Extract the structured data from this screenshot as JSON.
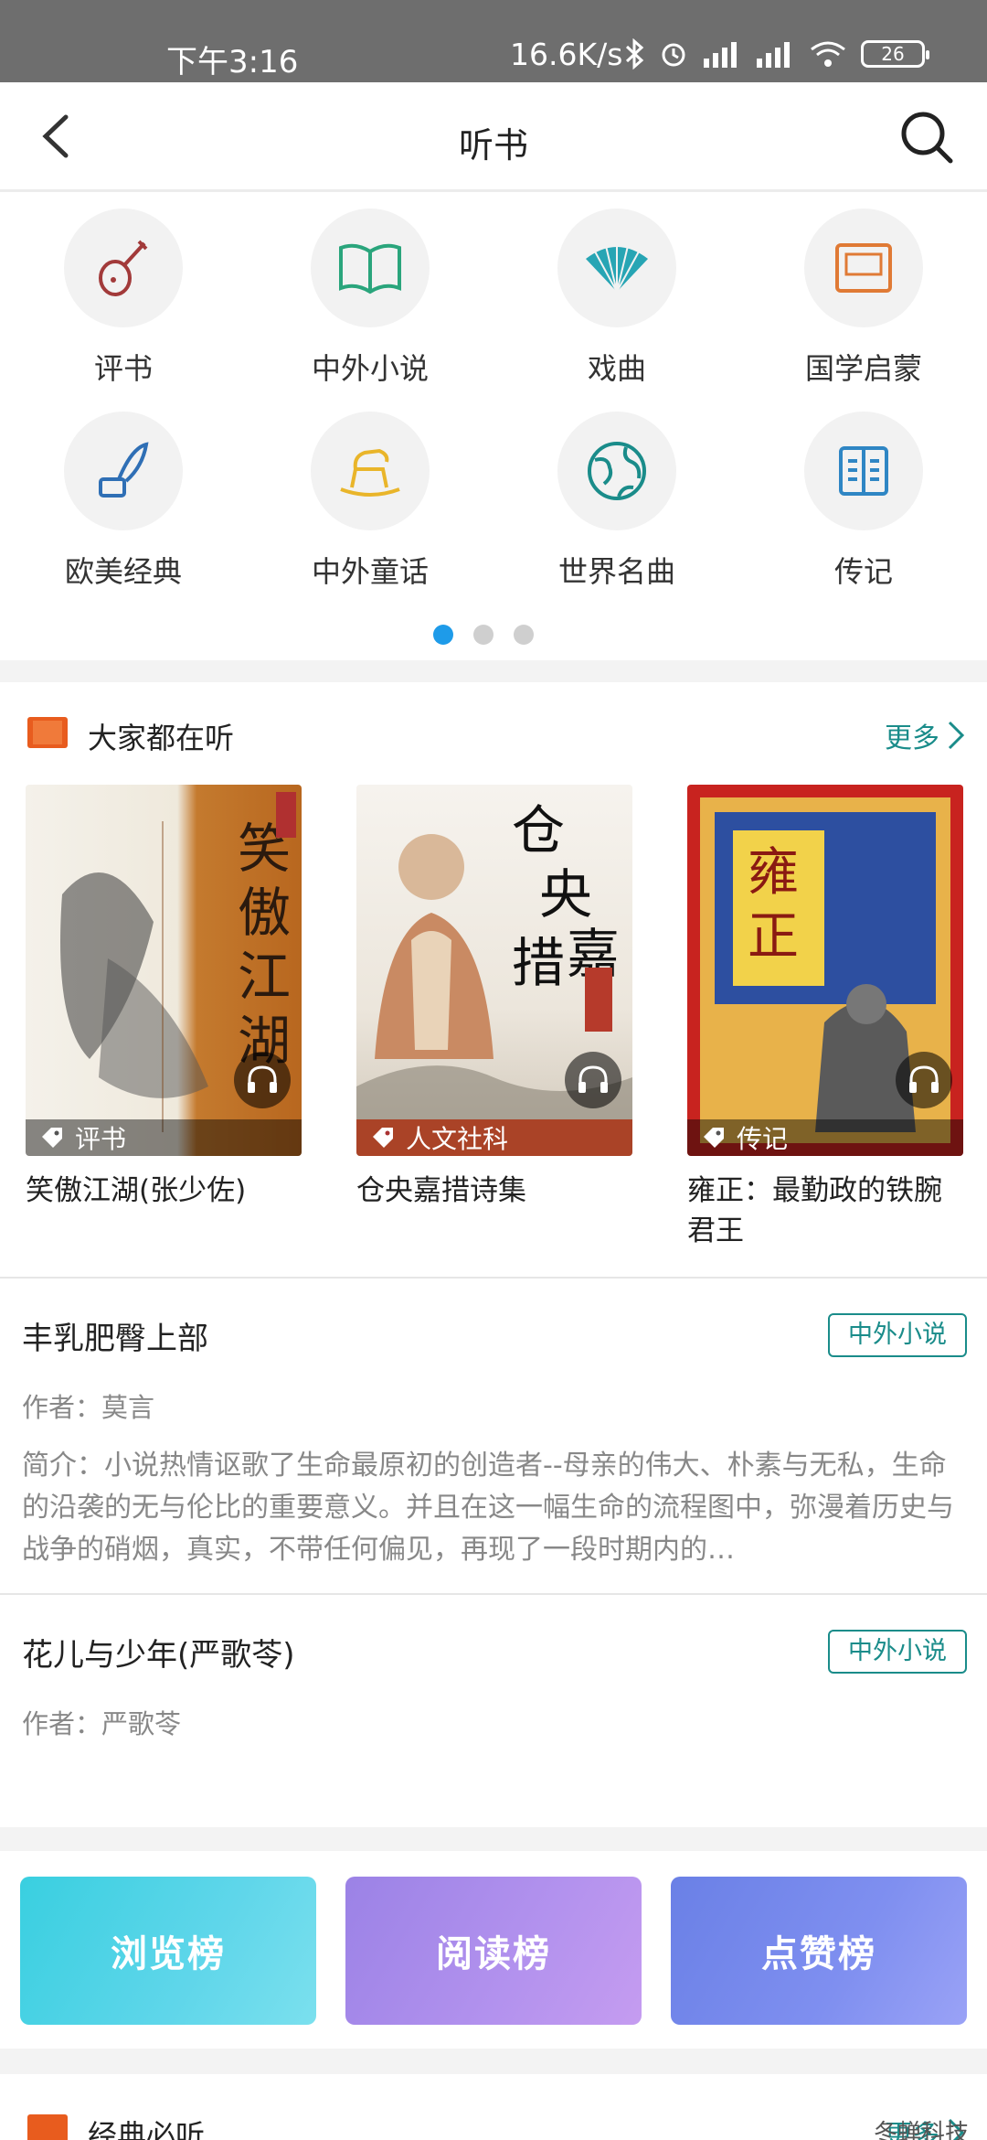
{
  "status": {
    "time": "下午3:16",
    "speed": "16.6K/s",
    "battery": "26"
  },
  "nav": {
    "title": "听书"
  },
  "categories": [
    {
      "label": "评书",
      "icon": "pipa-icon"
    },
    {
      "label": "中外小说",
      "icon": "open-book-icon"
    },
    {
      "label": "戏曲",
      "icon": "fan-icon"
    },
    {
      "label": "国学启蒙",
      "icon": "sishu-icon"
    },
    {
      "label": "欧美经典",
      "icon": "quill-ink-icon"
    },
    {
      "label": "中外童话",
      "icon": "rocking-horse-icon"
    },
    {
      "label": "世界名曲",
      "icon": "globe-icon"
    },
    {
      "label": "传记",
      "icon": "document-icon"
    }
  ],
  "pager": {
    "active_index": 0,
    "count": 3
  },
  "popular": {
    "title": "大家都在听",
    "more": "更多",
    "books": [
      {
        "title": "笑傲江湖(张少佐)",
        "tag": "评书"
      },
      {
        "title": "仓央嘉措诗集",
        "tag": "人文社科"
      },
      {
        "title": "雍正：最勤政的铁腕君王",
        "tag": "传记"
      }
    ]
  },
  "list": [
    {
      "title": "丰乳肥臀上部",
      "tag": "中外小说",
      "author": "作者：莫言",
      "desc": "简介：小说热情讴歌了生命最原初的创造者--母亲的伟大、朴素与无私，生命的沿袭的无与伦比的重要意义。并且在这一幅生命的流程图中，弥漫着历史与战争的硝烟，真实，不带任何偏见，再现了一段时期内的…"
    },
    {
      "title": "花儿与少年(严歌苓)",
      "tag": "中外小说",
      "author": "作者：严歌苓"
    }
  ],
  "ranks": [
    "浏览榜",
    "阅读榜",
    "点赞榜"
  ],
  "bottom_section": {
    "title": "经典必听",
    "more": "更多"
  },
  "watermark": "冬蝉科技",
  "colors": {
    "accent": "#1a8c8a",
    "pager_active": "#1e9be9",
    "status_bar": "#6e6e6e"
  }
}
